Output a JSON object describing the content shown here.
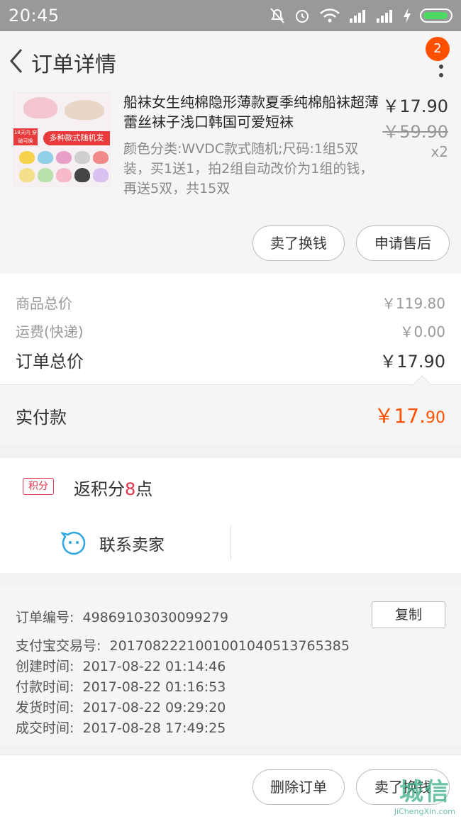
{
  "status_bar": {
    "time": "20:45"
  },
  "nav": {
    "title": "订单详情",
    "badge_count": "2"
  },
  "product": {
    "title": "船袜女生纯棉隐形薄款夏季纯棉船袜超薄蕾丝袜子浅口韩国可爱短袜",
    "spec": "颜色分类:WVDC款式随机;尺码:1组5双装，买1送1，拍2组自动改价为1组的钱，再送5双，共15双",
    "price": "￥17.90",
    "original_price": "￥59.90",
    "quantity": "x2",
    "thumb_banner": "多种款式随机发",
    "thumb_tag": "18天内 穿破可换"
  },
  "product_actions": {
    "sell_label": "卖了换钱",
    "aftersale_label": "申请售后"
  },
  "summary": {
    "goods_label": "商品总价",
    "goods_value": "￥119.80",
    "shipping_label": "运费(快递)",
    "shipping_value": "￥0.00",
    "total_label": "订单总价",
    "total_value": "￥17.90"
  },
  "paid": {
    "label": "实付款",
    "amount_main": "￥17.",
    "amount_cents": "90"
  },
  "points": {
    "badge": "积分",
    "prefix": "返积分",
    "number": "8",
    "suffix": "点"
  },
  "contact": {
    "label": "联系卖家"
  },
  "order_info": {
    "order_no_label": "订单编号:",
    "order_no": "49869103030099279",
    "copy_label": "复制",
    "alipay_label": "支付宝交易号:",
    "alipay_no": "2017082221001001040513765385",
    "created_label": "创建时间:",
    "created": "2017-08-22 01:14:46",
    "paid_label": "付款时间:",
    "paid": "2017-08-22 01:16:53",
    "shipped_label": "发货时间:",
    "shipped": "2017-08-22 09:29:20",
    "closed_label": "成交时间:",
    "closed": "2017-08-28 17:49:25"
  },
  "bottom_actions": {
    "delete_label": "删除订单",
    "sell_label": "卖了换钱"
  },
  "watermark": {
    "text": "城信",
    "sub": "JiChengXin.com"
  },
  "colors": {
    "accent": "#ff5000",
    "points_red": "#e5344e",
    "contact_blue": "#2ea7e0"
  }
}
